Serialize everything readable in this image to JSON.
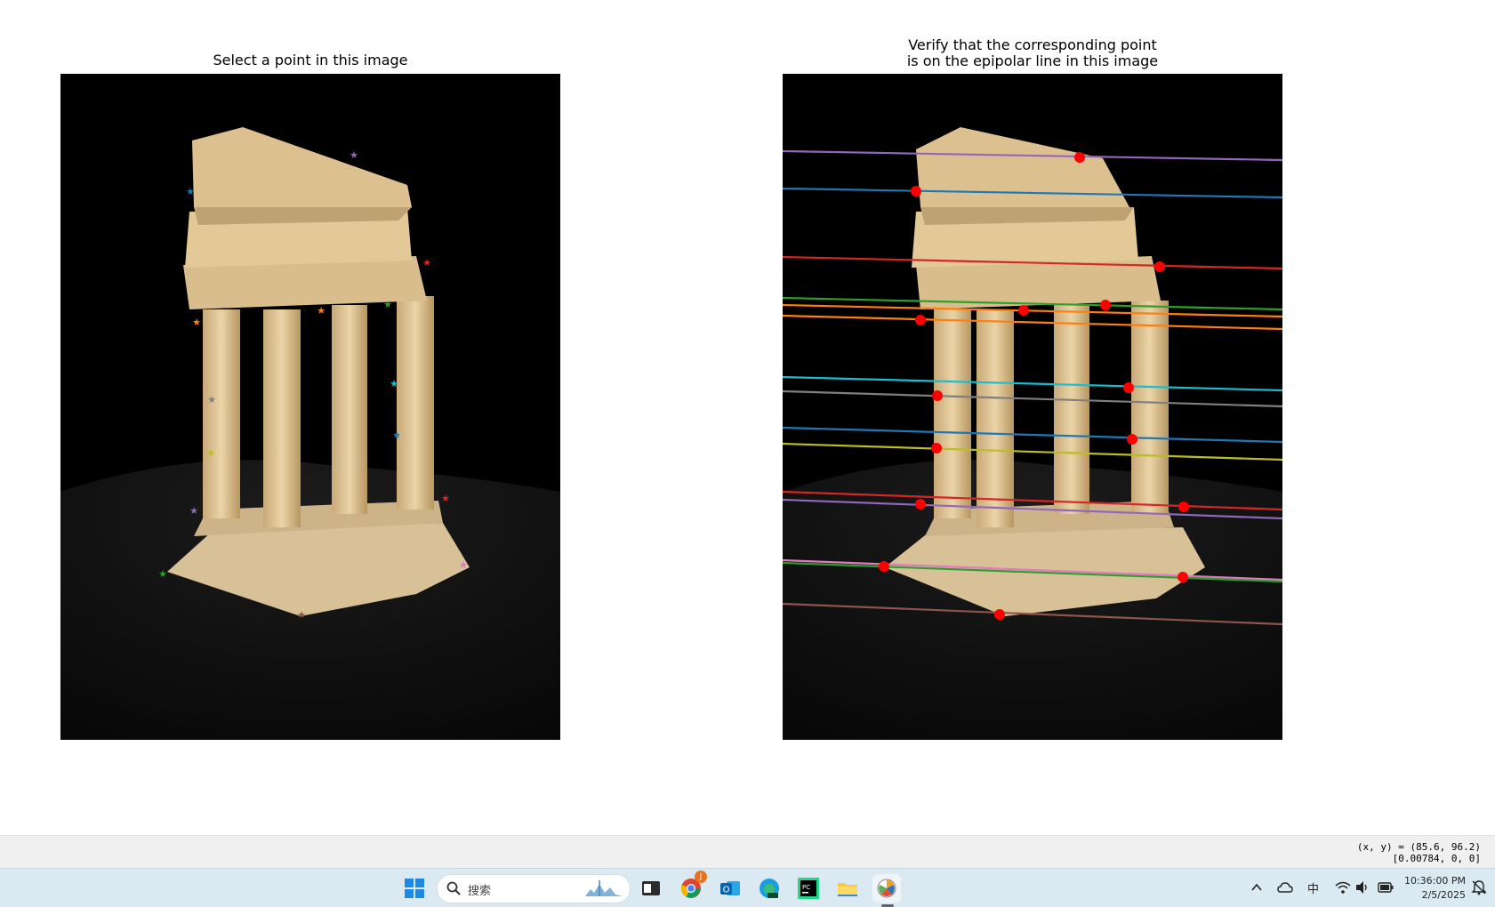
{
  "figure": {
    "left_title": "Select a point in this image",
    "right_title": "Verify that the corresponding point\n is on the epipolar line in this image"
  },
  "status": {
    "coords_line1": "(x, y) = (85.6, 96.2)",
    "coords_line2": "[0.00784, 0, 0]"
  },
  "taskbar": {
    "search_placeholder": "搜索",
    "ime_label": "中",
    "time": "10:36:00 PM",
    "date": "2/5/2025",
    "badge_count": "J",
    "apps": [
      "start-icon",
      "search-icon",
      "terminal-icon",
      "chrome-icon",
      "outlook-icon",
      "edge-dev-icon",
      "pycharm-icon",
      "file-explorer-icon",
      "matplotlib-figure-icon"
    ]
  },
  "colors": {
    "point_marker": "#ff0000",
    "epipolar_lines": [
      "#9467bd",
      "#1f77b4",
      "#d62728",
      "#2ca02c",
      "#ff7f0e",
      "#ff7f0e",
      "#17becf",
      "#7f7f7f",
      "#1f77b4",
      "#bcbd22",
      "#d62728",
      "#9467bd",
      "#e377c2",
      "#2ca02c",
      "#8c564b"
    ]
  }
}
